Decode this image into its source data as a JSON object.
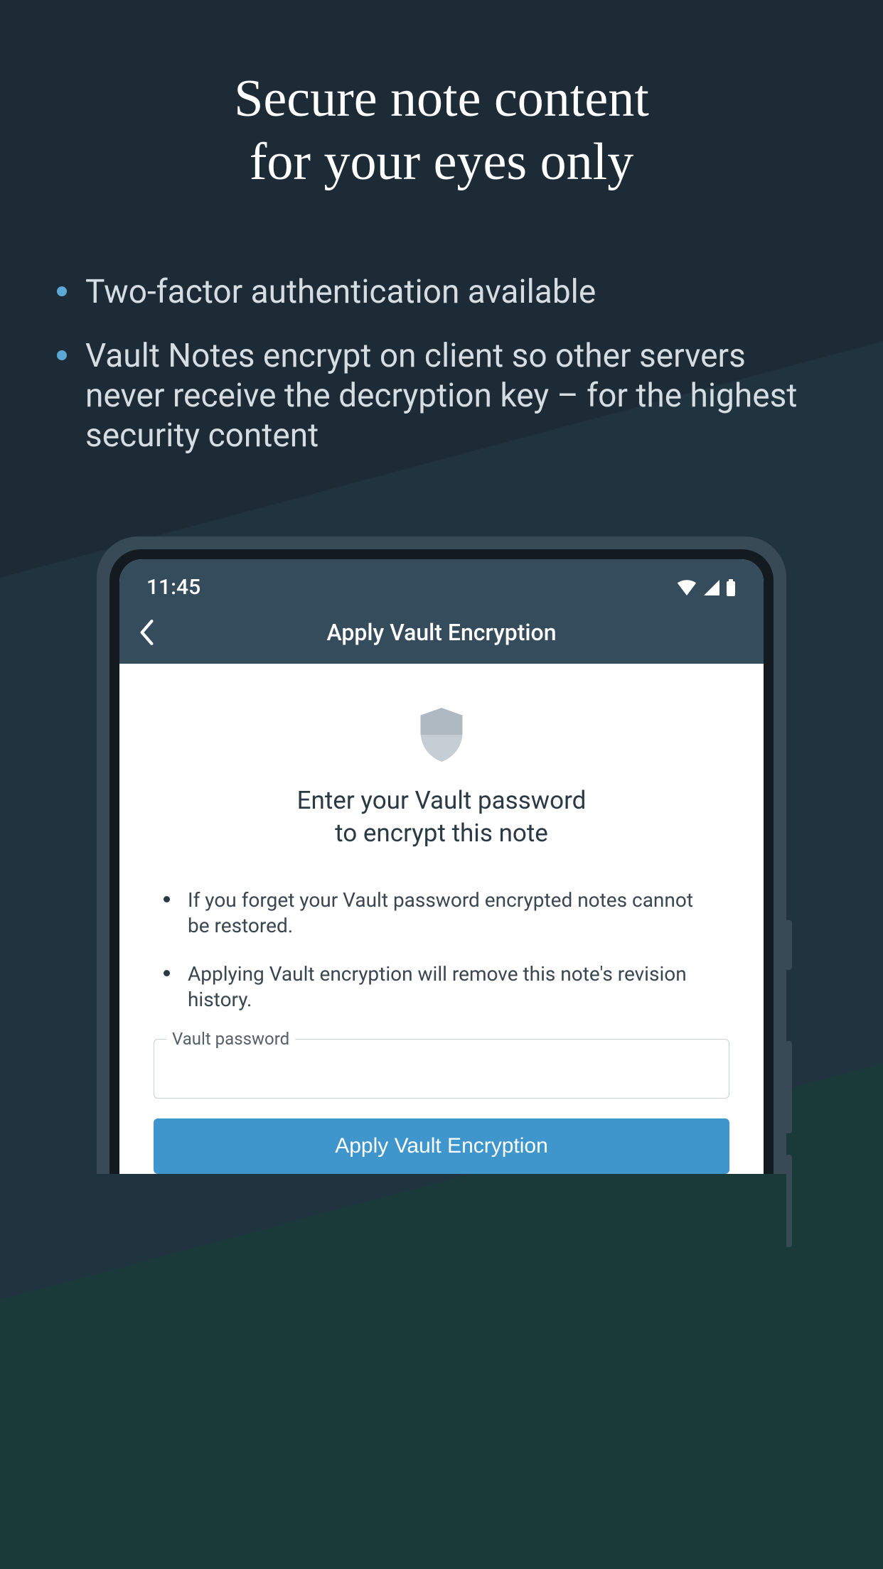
{
  "hero": {
    "line1": "Secure note content",
    "line2": "for your eyes only"
  },
  "features": {
    "item1": "Two-factor authentication available",
    "item2": "Vault Notes encrypt on client so other servers never receive the decryption key – for the highest security content"
  },
  "phone": {
    "status": {
      "time": "11:45"
    },
    "appbar": {
      "title": "Apply Vault Encryption"
    },
    "prompt": {
      "line1": "Enter your Vault password",
      "line2": "to encrypt this note"
    },
    "warnings": {
      "w1": "If you forget your Vault password encrypted notes cannot be restored.",
      "w2": "Applying Vault encryption will remove this note's revision history."
    },
    "field": {
      "label": "Vault password",
      "value": ""
    },
    "button": {
      "label": "Apply Vault Encryption"
    }
  }
}
